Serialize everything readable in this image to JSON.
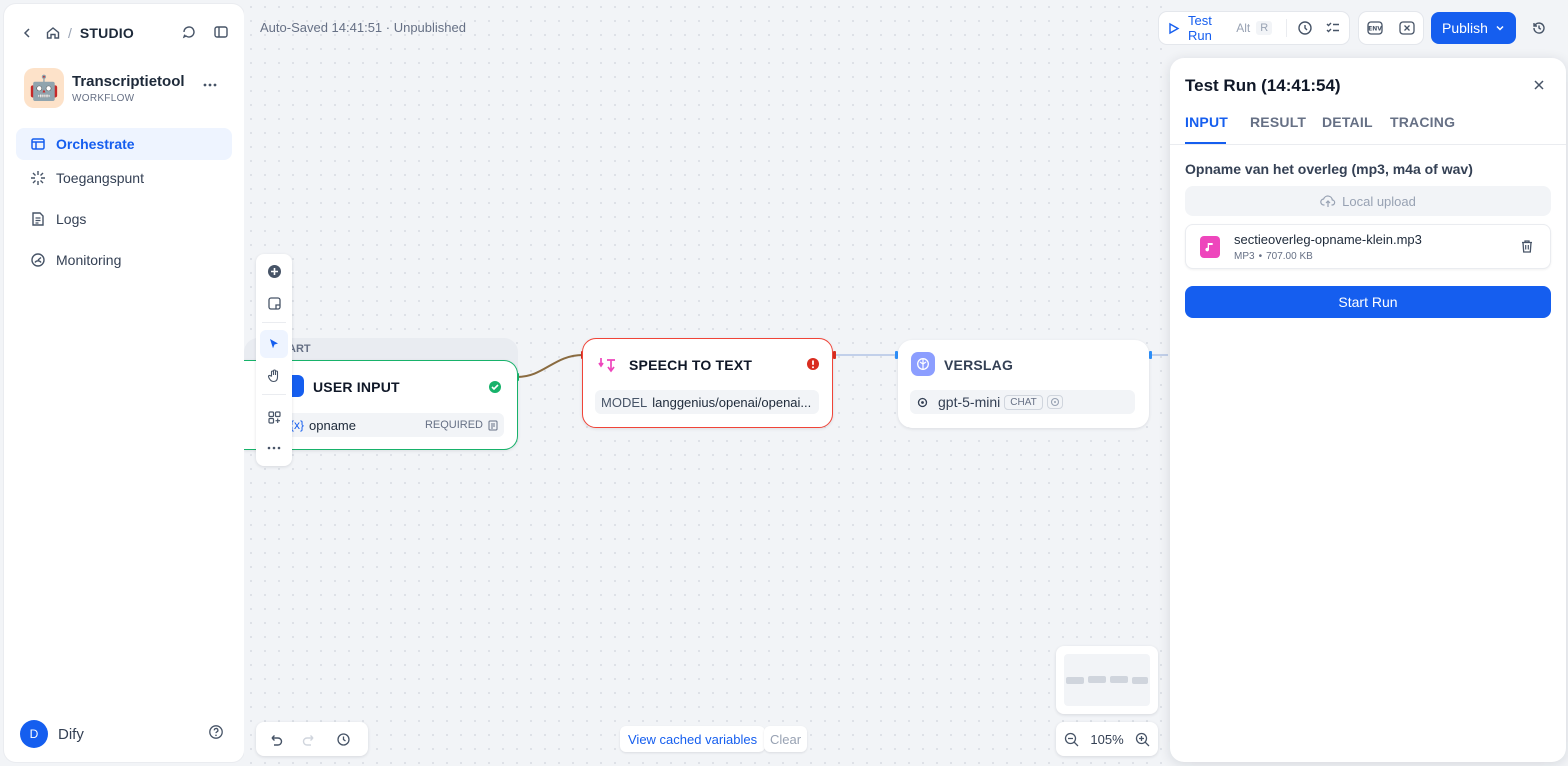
{
  "header": {
    "studio": "STUDIO"
  },
  "app": {
    "name": "Transcriptietool",
    "type": "WORKFLOW",
    "icon": "robot-emoji"
  },
  "nav": [
    {
      "label": "Orchestrate",
      "icon": "orchestrate-icon",
      "active": true
    },
    {
      "label": "Toegangspunt",
      "icon": "access-point-icon",
      "active": false
    },
    {
      "label": "Logs",
      "icon": "logs-icon",
      "active": false
    },
    {
      "label": "Monitoring",
      "icon": "monitoring-icon",
      "active": false
    }
  ],
  "user": {
    "initial": "D",
    "name": "Dify"
  },
  "canvas": {
    "autosave": "Auto-Saved 14:41:51 · Unpublished",
    "start_node": {
      "badge": "ART",
      "title": "USER INPUT",
      "var": "opname",
      "required": "REQUIRED"
    },
    "stt_node": {
      "title": "SPEECH TO TEXT",
      "model_label": "MODEL",
      "model_value": "langgenius/openai/openai..."
    },
    "verslag_node": {
      "title": "VERSLAG",
      "model": "gpt-5-mini",
      "mode": "CHAT"
    },
    "cached": "View cached variables",
    "clear": "Clear",
    "zoom": "105%"
  },
  "topbar": {
    "test_run": "Test Run",
    "shortcut_alt": "Alt",
    "shortcut_key": "R",
    "publish": "Publish"
  },
  "panel": {
    "title": "Test Run (14:41:54)",
    "tabs": [
      "INPUT",
      "RESULT",
      "DETAIL",
      "TRACING"
    ],
    "field_label": "Opname van het overleg (mp3, m4a of wav)",
    "upload": "Local upload",
    "file": {
      "name": "sectieoverleg-opname-klein.mp3",
      "type": "MP3",
      "size": "707.00 KB"
    },
    "start": "Start Run"
  },
  "colors": {
    "accent": "#155eef",
    "error": "#d92d20",
    "success": "#17b26a",
    "file": "#ee46bc"
  }
}
